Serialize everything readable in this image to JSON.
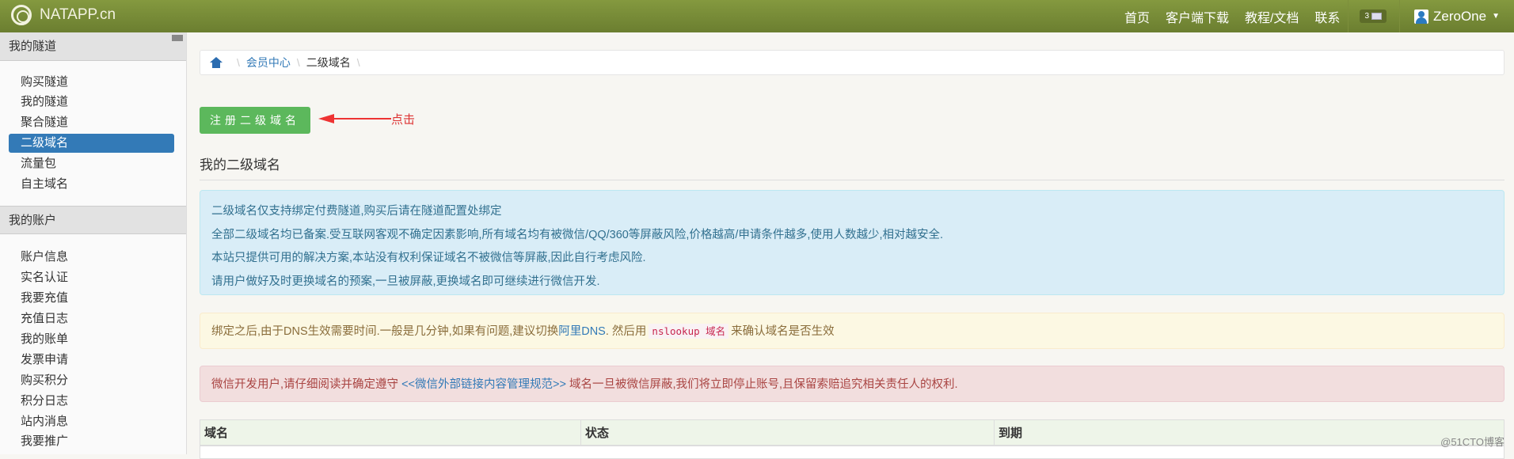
{
  "header": {
    "brand": "NATAPP.cn",
    "nav": [
      "首页",
      "客户端下载",
      "教程/文档",
      "联系"
    ],
    "mail_count": "3",
    "user": "ZeroOne"
  },
  "sidebar": {
    "section1": "我的隧道",
    "items1": [
      "购买隧道",
      "我的隧道",
      "聚合隧道",
      "二级域名",
      "流量包",
      "自主域名"
    ],
    "active": "二级域名",
    "section2": "我的账户",
    "items2": [
      "账户信息",
      "实名认证",
      "我要充值",
      "充值日志",
      "我的账单",
      "发票申请",
      "购买积分",
      "积分日志",
      "站内消息",
      "我要推广"
    ]
  },
  "breadcrumb": {
    "parent": "会员中心",
    "current": "二级域名"
  },
  "register_button": "注册二级域名",
  "annotation": "点击",
  "heading": "我的二级域名",
  "info_lines": [
    "二级域名仅支持绑定付费隧道,购买后请在隧道配置处绑定",
    "全部二级域名均已备案.受互联网客观不确定因素影响,所有域名均有被微信/QQ/360等屏蔽风险,价格越高/申请条件越多,使用人数越少,相对越安全.",
    "本站只提供可用的解决方案,本站没有权利保证域名不被微信等屏蔽,因此自行考虑风险.",
    "请用户做好及时更换域名的预案,一旦被屏蔽,更换域名即可继续进行微信开发."
  ],
  "warning": {
    "pre": "绑定之后,由于DNS生效需要时间.一般是几分钟,如果有问题,建议切换",
    "link": "阿里DNS",
    "mid": ". 然后用",
    "code": "nslookup 域名",
    "post": "来确认域名是否生效"
  },
  "danger": {
    "pre": "微信开发用户,请仔细阅读并确定遵守",
    "link": "<<微信外部链接内容管理规范>>",
    "post": "域名一旦被微信屏蔽,我们将立即停止账号,且保留索赔追究相关责任人的权利."
  },
  "table": {
    "columns": [
      "域名",
      "状态",
      "到期"
    ]
  },
  "watermark": "@51CTO博客"
}
